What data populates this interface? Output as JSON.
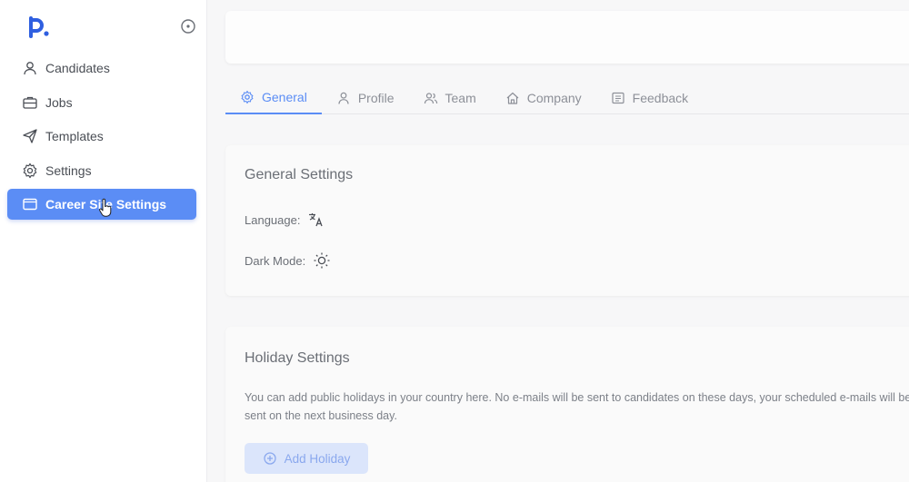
{
  "sidebar": {
    "logo": "p.",
    "items": [
      {
        "label": "Candidates",
        "icon": "user-icon"
      },
      {
        "label": "Jobs",
        "icon": "briefcase-icon"
      },
      {
        "label": "Templates",
        "icon": "send-icon"
      },
      {
        "label": "Settings",
        "icon": "gear-icon"
      },
      {
        "label": "Career Site Settings",
        "icon": "window-icon",
        "active": true
      }
    ]
  },
  "tabs": [
    {
      "label": "General",
      "icon": "gear-icon",
      "active": true
    },
    {
      "label": "Profile",
      "icon": "user-icon"
    },
    {
      "label": "Team",
      "icon": "team-icon"
    },
    {
      "label": "Company",
      "icon": "home-icon"
    },
    {
      "label": "Feedback",
      "icon": "list-icon"
    }
  ],
  "general_settings": {
    "title": "General Settings",
    "language_label": "Language:",
    "dark_mode_label": "Dark Mode:"
  },
  "holiday_settings": {
    "title": "Holiday Settings",
    "description": "You can add public holidays in your country here. No e-mails will be sent to candidates on these days, your scheduled e-mails will be sent on the next business day.",
    "add_button": "Add Holiday"
  },
  "colors": {
    "accent": "#5b8df5",
    "logo": "#2f5fe0"
  }
}
